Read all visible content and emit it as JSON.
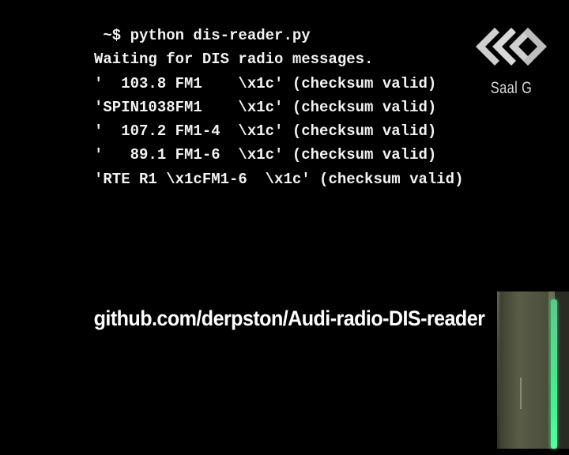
{
  "terminal": {
    "lines": [
      " ~$ python dis-reader.py",
      "Waiting for DIS radio messages.",
      "'  103.8 FM1    \\x1c' (checksum valid)",
      "'SPIN1038FM1    \\x1c' (checksum valid)",
      "'  107.2 FM1-4  \\x1c' (checksum valid)",
      "'   89.1 FM1-6  \\x1c' (checksum valid)",
      "'RTE R1 \\x1cFM1-6  \\x1c' (checksum valid)"
    ]
  },
  "caption": {
    "url": "github.com/derpston/Audi-radio-DIS-reader"
  },
  "watermark": {
    "label": "Saal G",
    "icon": "ccc-logo-icon"
  },
  "pip": {
    "icon": "inset-video"
  }
}
